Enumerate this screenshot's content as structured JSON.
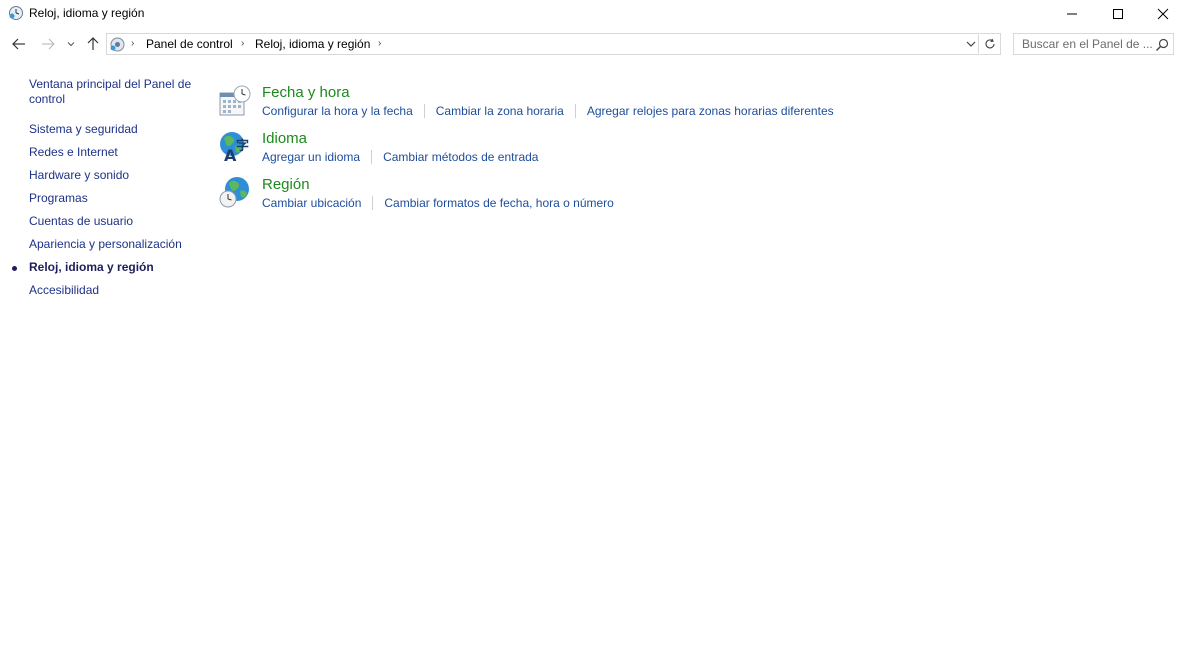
{
  "window": {
    "title": "Reloj, idioma y región"
  },
  "address": {
    "crumbs": [
      "Panel de control",
      "Reloj, idioma y región"
    ]
  },
  "search": {
    "placeholder": "Buscar en el Panel de ..."
  },
  "sidebar": {
    "items": [
      "Ventana principal del Panel de control",
      "Sistema y seguridad",
      "Redes e Internet",
      "Hardware y sonido",
      "Programas",
      "Cuentas de usuario",
      "Apariencia y personalización",
      "Reloj, idioma y región",
      "Accesibilidad"
    ],
    "current_index": 7
  },
  "categories": [
    {
      "title": "Fecha y hora",
      "icon": "calendar-clock-icon",
      "links": [
        "Configurar la hora y la fecha",
        "Cambiar la zona horaria",
        "Agregar relojes para zonas horarias diferentes"
      ]
    },
    {
      "title": "Idioma",
      "icon": "globe-language-icon",
      "links": [
        "Agregar un idioma",
        "Cambiar métodos de entrada"
      ]
    },
    {
      "title": "Región",
      "icon": "globe-clock-icon",
      "links": [
        "Cambiar ubicación",
        "Cambiar formatos de fecha, hora o número"
      ]
    }
  ],
  "colors": {
    "link": "#1e4d9b",
    "category_title": "#1d8a1d",
    "sidebar_link": "#1e3287"
  }
}
